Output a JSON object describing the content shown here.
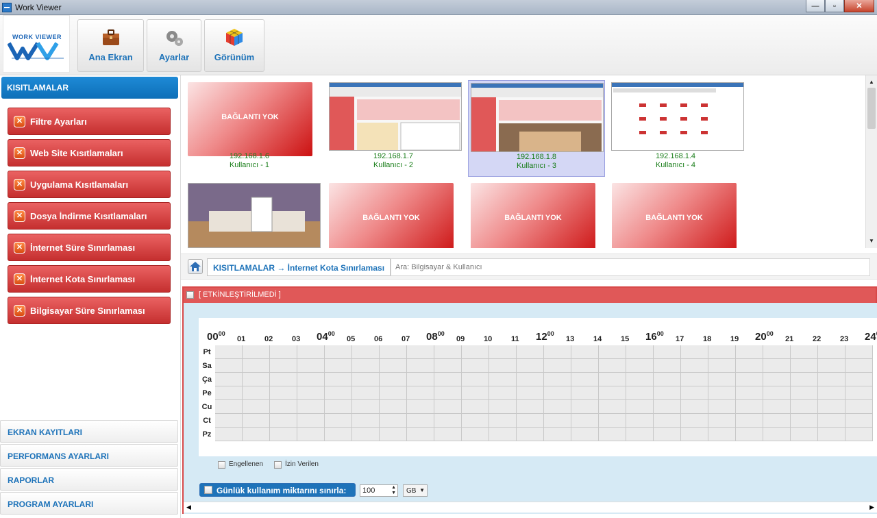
{
  "window": {
    "title": "Work Viewer",
    "min": "—",
    "max": "▫",
    "close": "✕"
  },
  "logo": {
    "text": "WORK VIEWER"
  },
  "toolbar": {
    "buttons": [
      {
        "label": "Ana Ekran"
      },
      {
        "label": "Ayarlar"
      },
      {
        "label": "Görünüm"
      }
    ]
  },
  "sidebar": {
    "header": "KISITLAMALAR",
    "items": [
      {
        "label": "Filtre Ayarları"
      },
      {
        "label": "Web Site Kısıtlamaları"
      },
      {
        "label": "Uygulama Kısıtlamaları"
      },
      {
        "label": "Dosya İndirme Kısıtlamaları"
      },
      {
        "label": "İnternet Süre Sınırlaması"
      },
      {
        "label": "İnternet Kota Sınırlaması"
      },
      {
        "label": "Bilgisayar Süre Sınırlaması"
      }
    ],
    "bottom": [
      {
        "label": "EKRAN KAYITLARI"
      },
      {
        "label": "PERFORMANS AYARLARI"
      },
      {
        "label": "RAPORLAR"
      },
      {
        "label": "PROGRAM AYARLARI"
      }
    ]
  },
  "thumbnails": {
    "no_connection_text": "BAĞLANTI YOK",
    "row1": [
      {
        "ip": "192.168.1.6",
        "user": "Kullanıcı - 1",
        "connected": false
      },
      {
        "ip": "192.168.1.7",
        "user": "Kullanıcı - 2",
        "connected": true
      },
      {
        "ip": "192.168.1.8",
        "user": "Kullanıcı - 3",
        "connected": true,
        "selected": true
      },
      {
        "ip": "192.168.1.4",
        "user": "Kullanıcı - 4",
        "connected": true
      }
    ]
  },
  "breadcrumb": {
    "path": "KISITLAMALAR  →  İnternet Kota Sınırlaması",
    "search_placeholder": "Ara: Bilgisayar & Kullanıcı"
  },
  "panel": {
    "status": "[ ETKİNLEŞTİRİLMEDİ ]",
    "hours": [
      "00",
      "01",
      "02",
      "03",
      "04",
      "05",
      "06",
      "07",
      "08",
      "09",
      "10",
      "11",
      "12",
      "13",
      "14",
      "15",
      "16",
      "17",
      "18",
      "19",
      "20",
      "21",
      "22",
      "23",
      "24"
    ],
    "big_hours_sup": "00",
    "days": [
      "Pt",
      "Sa",
      "Ça",
      "Pe",
      "Cu",
      "Ct",
      "Pz"
    ],
    "legend_blocked": "Engellenen",
    "legend_allowed": "İzin Verilen",
    "limit_label": "Günlük kullanım miktarını sınırla:",
    "limit_value": "100",
    "limit_unit": "GB"
  },
  "colors": {
    "accent": "#1e73b9",
    "danger": "#c52f2f",
    "ok": "#187d18"
  }
}
